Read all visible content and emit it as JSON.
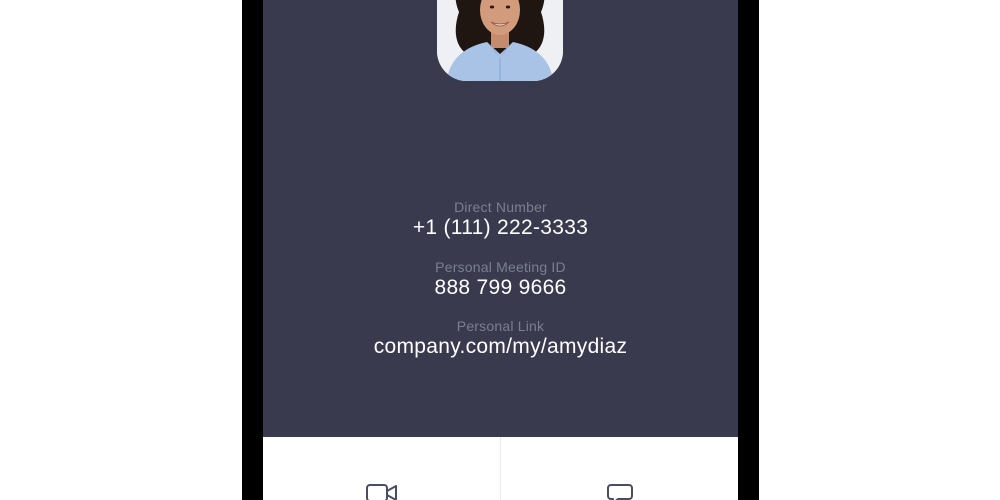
{
  "profile": {
    "photo_alt": "Profile photo"
  },
  "details": [
    {
      "label": "Direct Number",
      "value": "+1 (111) 222-3333"
    },
    {
      "label": "Personal Meeting ID",
      "value": "888 799 9666"
    },
    {
      "label": "Personal Link",
      "value": "company.com/my/amydiaz"
    }
  ],
  "actions": [
    {
      "icon": "video-camera-icon"
    },
    {
      "icon": "chat-bubble-icon"
    }
  ],
  "colors": {
    "screen_background": "#393a4e",
    "label_text": "#7b7e93",
    "value_text": "#ffffff",
    "icon_stroke": "#4a4c63"
  }
}
